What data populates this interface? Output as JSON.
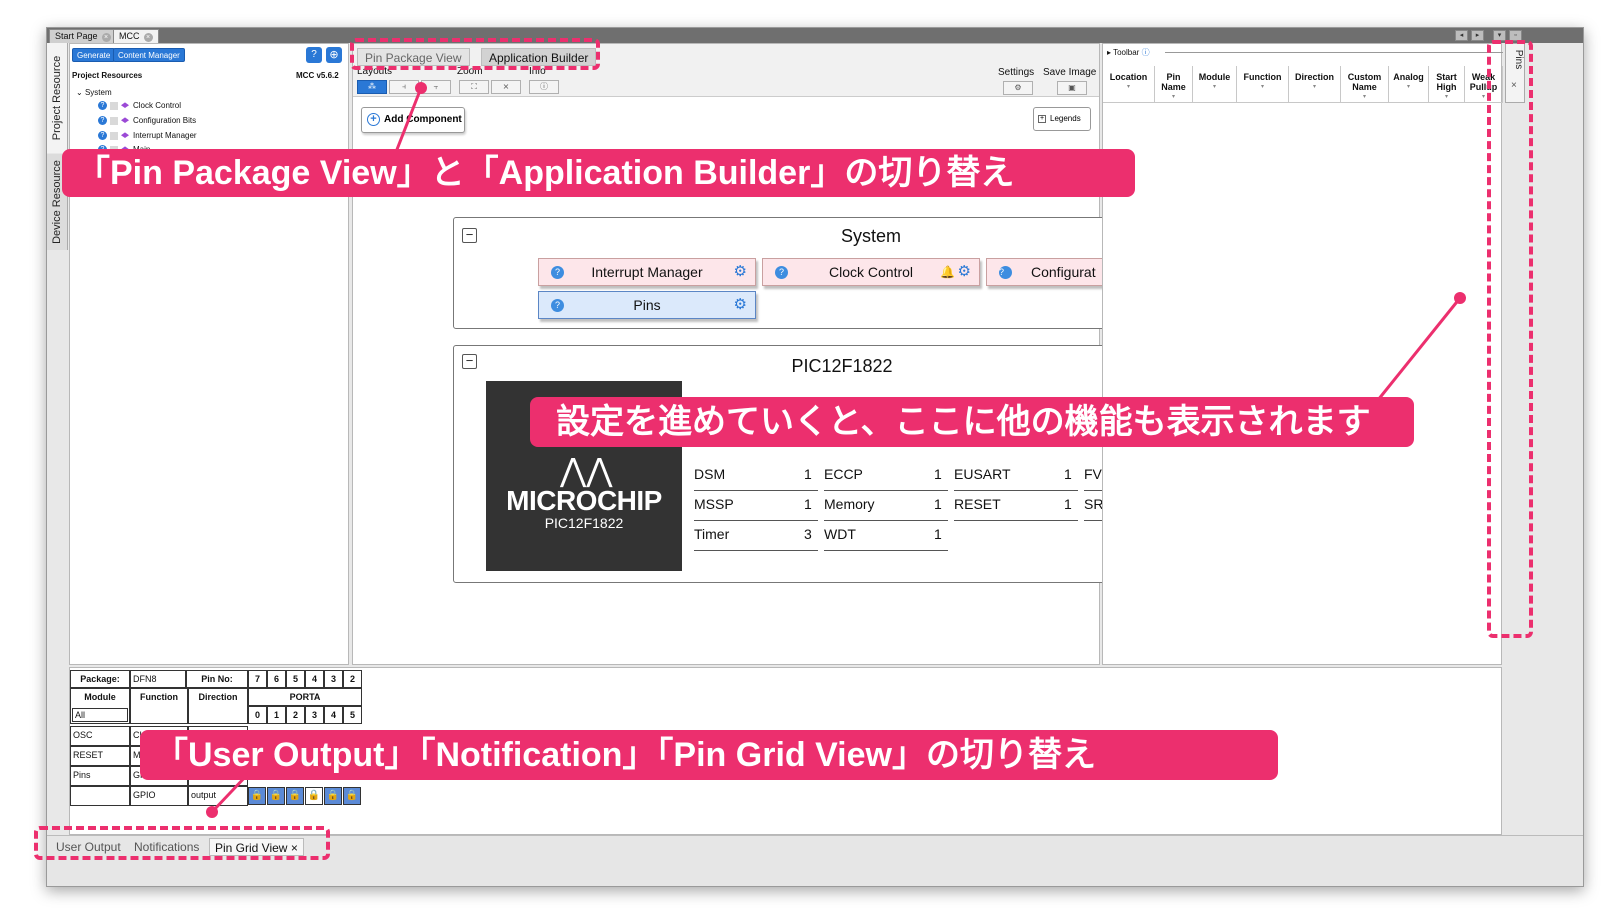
{
  "top_tabs": [
    {
      "label": "Start Page"
    },
    {
      "label": "MCC"
    }
  ],
  "window_controls": [
    "◂",
    "▸",
    "▾",
    "▫"
  ],
  "left_vtabs": [
    "Project Resource",
    "Device Resource"
  ],
  "project": {
    "generate": "Generate",
    "content_manager": "Content Manager",
    "title": "Project Resources",
    "version": "MCC v5.6.2",
    "system_node": "System",
    "items": [
      "Clock Control",
      "Configuration Bits",
      "Interrupt Manager",
      "Main"
    ]
  },
  "center": {
    "tab_pin_package": "Pin Package View",
    "tab_app_builder": "Application Builder",
    "layouts": "Layouts",
    "zoom": "Zoom",
    "info": "Info",
    "settings": "Settings",
    "save_image": "Save Image",
    "add_component": "Add Component",
    "legends": "Legends",
    "system_title": "System",
    "components": {
      "interrupt_manager": "Interrupt Manager",
      "clock_control": "Clock Control",
      "configuration": "Configurat",
      "pins": "Pins"
    },
    "device_title": "PIC12F1822",
    "chip_brand": "MICROCHIP",
    "chip_part": "PIC12F1822",
    "modules": [
      {
        "name": "DSM",
        "count": "1"
      },
      {
        "name": "ECCP",
        "count": "1"
      },
      {
        "name": "EUSART",
        "count": "1"
      },
      {
        "name": "FV",
        "count": ""
      },
      {
        "name": "MSSP",
        "count": "1"
      },
      {
        "name": "Memory",
        "count": "1"
      },
      {
        "name": "RESET",
        "count": "1"
      },
      {
        "name": "SR",
        "count": ""
      },
      {
        "name": "Timer",
        "count": "3"
      },
      {
        "name": "WDT",
        "count": "1"
      }
    ]
  },
  "right": {
    "toolbar": "Toolbar",
    "headers": [
      "Location",
      "Pin Name",
      "Module",
      "Function",
      "Direction",
      "Custom Name",
      "Analog",
      "Start High",
      "Weak Pullup"
    ],
    "side_tab": "Pins"
  },
  "pingrid": {
    "package_label": "Package:",
    "package_value": "DFN8",
    "pin_no_label": "Pin No:",
    "pin_numbers": [
      "7",
      "6",
      "5",
      "4",
      "3",
      "2"
    ],
    "module_header": "Module",
    "function_header": "Function",
    "direction_header": "Direction",
    "port_header": "PORTA",
    "port_bits": [
      "0",
      "1",
      "2",
      "3",
      "4",
      "5"
    ],
    "module_filter": "All",
    "rows": [
      {
        "module": "OSC",
        "function": "CLK",
        "direction": ""
      },
      {
        "module": "RESET",
        "function": "MC",
        "direction": ""
      },
      {
        "module": "Pins",
        "function": "GPI",
        "direction": ""
      },
      {
        "module": "",
        "function": "GPIO",
        "direction": "output"
      }
    ]
  },
  "bottom_tabs": [
    "User Output",
    "Notifications",
    "Pin Grid View"
  ],
  "annotations": {
    "top": "「Pin Package View」と「Application Builder」の切り替え",
    "middle": "設定を進めていくと、ここに他の機能も表示されます",
    "bottom": "「User Output」「Notification」「Pin Grid View」の切り替え"
  },
  "colors": {
    "annotation": "#ec2f6e",
    "accent": "#2a78d6"
  }
}
